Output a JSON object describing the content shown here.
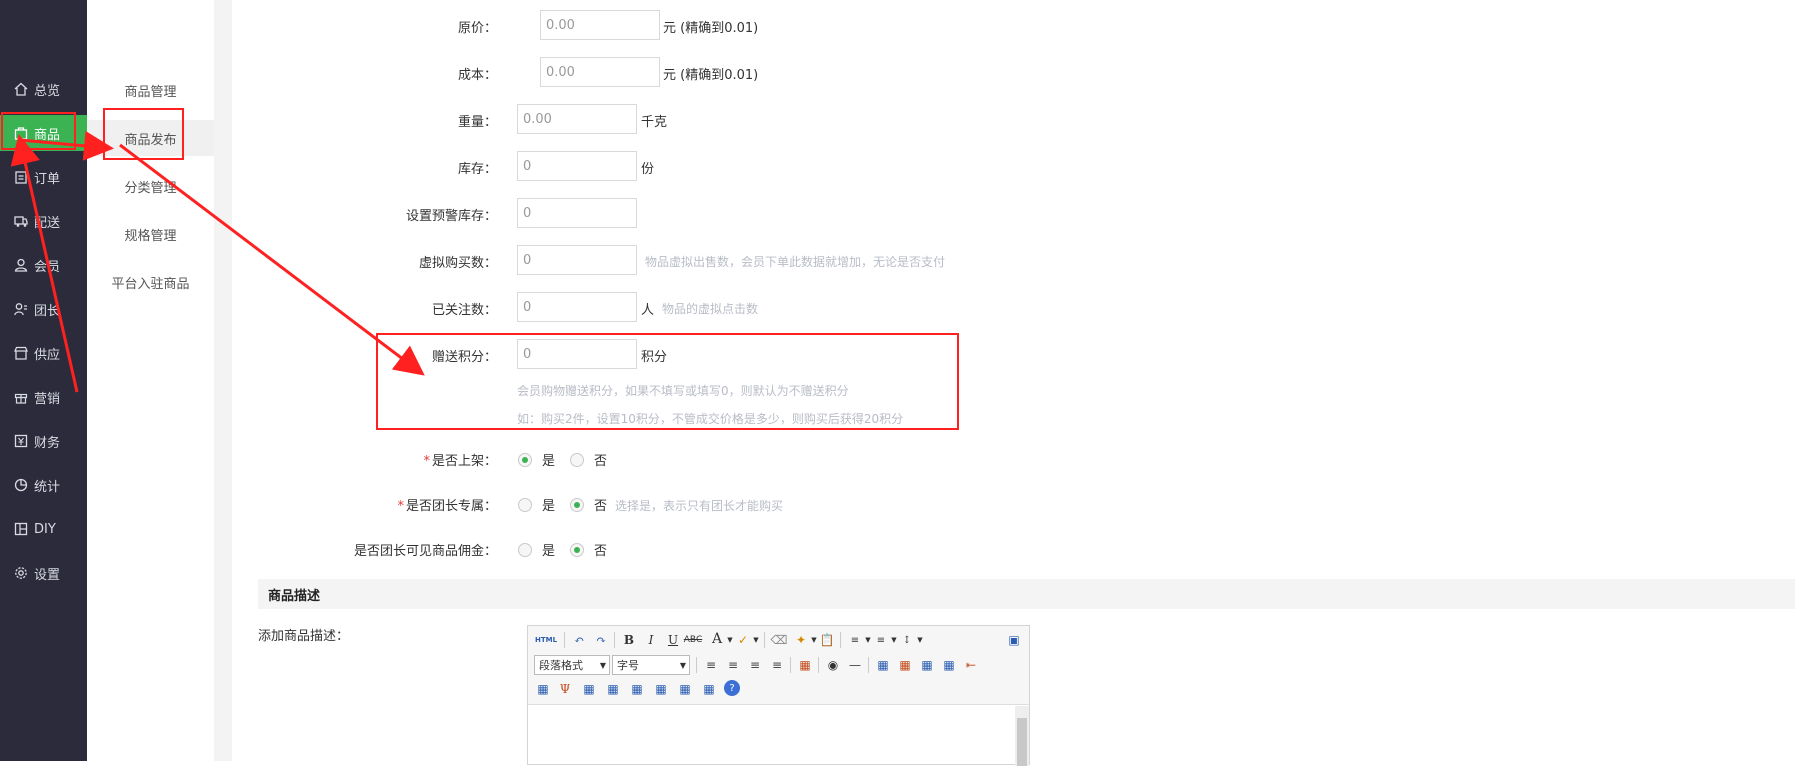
{
  "sidebar": {
    "items": [
      {
        "label": "总览",
        "icon": "home-icon"
      },
      {
        "label": "商品",
        "icon": "bag-icon",
        "active": true
      },
      {
        "label": "订单",
        "icon": "clipboard-icon"
      },
      {
        "label": "配送",
        "icon": "truck-icon"
      },
      {
        "label": "会员",
        "icon": "user-icon"
      },
      {
        "label": "团长",
        "icon": "user-group-icon"
      },
      {
        "label": "供应",
        "icon": "store-icon"
      },
      {
        "label": "营销",
        "icon": "gift-icon"
      },
      {
        "label": "财务",
        "icon": "finance-icon"
      },
      {
        "label": "统计",
        "icon": "pie-chart-icon"
      },
      {
        "label": "DIY",
        "icon": "layout-icon"
      },
      {
        "label": "设置",
        "icon": "gear-icon"
      }
    ]
  },
  "subnav": {
    "items": [
      {
        "label": "商品管理"
      },
      {
        "label": "商品发布",
        "active": true
      },
      {
        "label": "分类管理"
      },
      {
        "label": "规格管理"
      },
      {
        "label": "平台入驻商品"
      }
    ]
  },
  "form": {
    "original_price": {
      "label": "原价：",
      "value": "0.00",
      "unit": "元 (精确到0.01)"
    },
    "cost": {
      "label": "成本：",
      "value": "0.00",
      "unit": "元 (精确到0.01)"
    },
    "weight": {
      "label": "重量：",
      "value": "0.00",
      "unit": "千克"
    },
    "stock": {
      "label": "库存：",
      "value": "0",
      "unit": "份"
    },
    "warning_stock": {
      "label": "设置预警库存：",
      "value": "0"
    },
    "virtual_sales": {
      "label": "虚拟购买数：",
      "value": "0",
      "hint": "物品虚拟出售数，会员下单此数据就增加，无论是否支付"
    },
    "followers": {
      "label": "已关注数：",
      "value": "0",
      "unit": "人",
      "hint": "物品的虚拟点击数"
    },
    "gift_points": {
      "label": "赠送积分：",
      "value": "0",
      "unit": "积分",
      "hint1": "会员购物赠送积分，如果不填写或填写0，则默认为不赠送积分",
      "hint2": "如：购买2件，设置10积分，不管成交价格是多少，则购买后获得20积分"
    },
    "on_shelf": {
      "label": "是否上架：",
      "required": "*",
      "yes": "是",
      "no": "否",
      "selected": "yes"
    },
    "leader_only": {
      "label": "是否团长专属：",
      "required": "*",
      "yes": "是",
      "no": "否",
      "selected": "no",
      "hint": "选择是，表示只有团长才能购买"
    },
    "leader_commission": {
      "label": "是否团长可见商品佣金：",
      "yes": "是",
      "no": "否",
      "selected": "no"
    }
  },
  "description": {
    "section_title": "商品描述",
    "field_label": "添加商品描述：",
    "editor": {
      "html_button": "HTML",
      "paragraph_select": "段落格式",
      "font_size_select": "字号"
    }
  },
  "annotation_color": "#ff2020",
  "accent": "#3cb353"
}
